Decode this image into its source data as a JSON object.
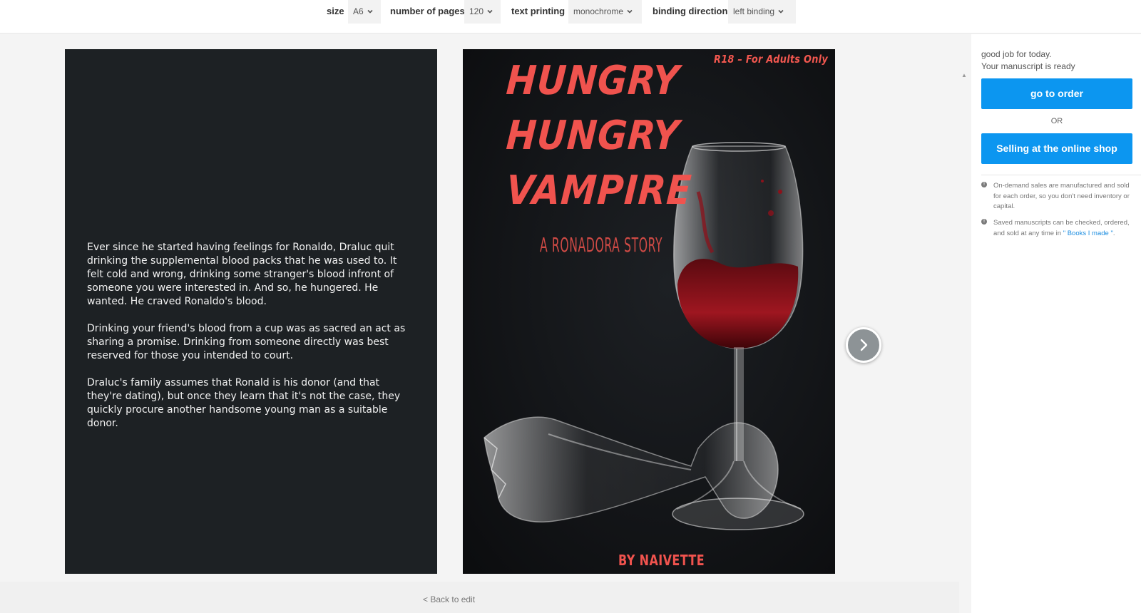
{
  "toolbar": {
    "size_label": "size",
    "size_value": "A6",
    "pages_label": "number of pages",
    "pages_value": "120",
    "printing_label": "text printing",
    "printing_value": "monochrome",
    "binding_label": "binding direction",
    "binding_value": "left binding"
  },
  "back_cover": {
    "paragraphs": [
      "Ever since he started having feelings for Ronaldo, Draluc quit drinking the supplemental blood packs that he was used to. It felt cold and wrong, drinking some stranger's blood infront of someone you were interested in. And so, he hungered. He wanted. He craved Ronaldo's blood.",
      "Drinking your friend's blood from a cup was as sacred an act as sharing a promise. Drinking from someone directly was best reserved for those you intended to court.",
      "Draluc's family assumes that Ronald is his donor (and that they're dating), but once they learn that it's not the case, they quickly procure another handsome young man as a suitable donor."
    ]
  },
  "front_cover": {
    "rating": "R18 – For Adults Only",
    "title_lines": [
      "HUNGRY",
      "HUNGRY",
      "VAMPIRE"
    ],
    "subtitle": "A RONADORA STORY",
    "author": "BY NAIVETTE"
  },
  "back_link": "< Back to edit",
  "sidebar": {
    "message_line1": "good job for today.",
    "message_line2": "Your manuscript is ready",
    "order_button": "go to order",
    "or_text": "OR",
    "shop_button": "Selling at the online shop",
    "note1": "On-demand sales are manufactured and sold for each order, so you don't need inventory or capital.",
    "note2_prefix": "Saved manuscripts can be checked, ordered, and sold at any time in ",
    "note2_link": "\" Books I made \"",
    "note2_suffix": "."
  },
  "colors": {
    "accent_blue": "#0c96f0",
    "cover_red": "#f0534e",
    "back_cover_bg": "#1d2124"
  },
  "icons": [
    "chevron-down-icon",
    "chevron-right-icon",
    "info-icon",
    "caret-up-icon"
  ]
}
